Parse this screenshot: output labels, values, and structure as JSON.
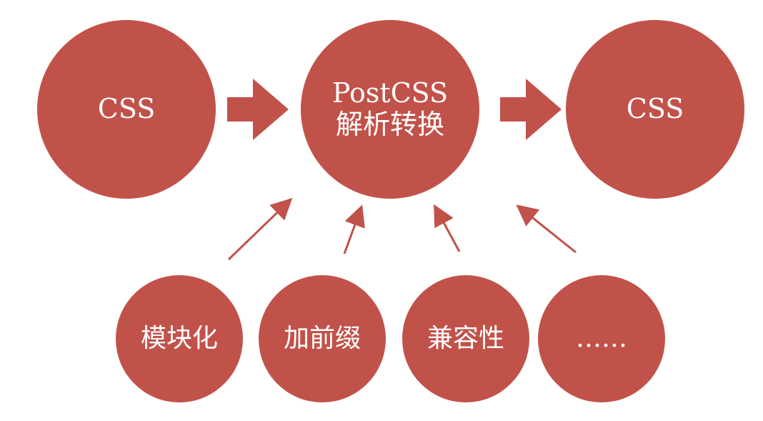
{
  "colors": {
    "node_fill": "#c1524a",
    "arrow": "#c1524a",
    "text": "#ffffff",
    "background": "#ffffff"
  },
  "nodes": {
    "input": {
      "label": "CSS"
    },
    "postcss": {
      "line1": "PostCSS",
      "line2": "解析转换"
    },
    "output": {
      "label": "CSS"
    }
  },
  "plugins": [
    {
      "label": "模块化"
    },
    {
      "label": "加前缀"
    },
    {
      "label": "兼容性"
    },
    {
      "label": "……"
    }
  ]
}
